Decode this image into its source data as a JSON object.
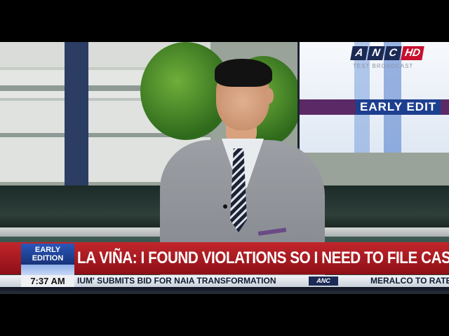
{
  "monitor": {
    "logo_letters": [
      "A",
      "N",
      "C",
      "HD"
    ],
    "sub_text": "TEST BROADCAST",
    "early_text": "EARLY EDIT"
  },
  "lower_third": {
    "headline": "LA VIÑA: I FOUND VIOLATIONS SO I NEED TO FILE CASES",
    "show_line1": "EARLY",
    "show_line2": "EDITION",
    "time": "7:37 AM"
  },
  "ticker": {
    "item1": "IUM' SUBMITS BID FOR NAIA TRANSFORMATION",
    "logo": "ANC",
    "item2": "MERALCO TO RATE"
  },
  "colors": {
    "headline_bar": "#c2262c",
    "show_box": "#2a56b8",
    "brand_hd": "#c8102e"
  }
}
